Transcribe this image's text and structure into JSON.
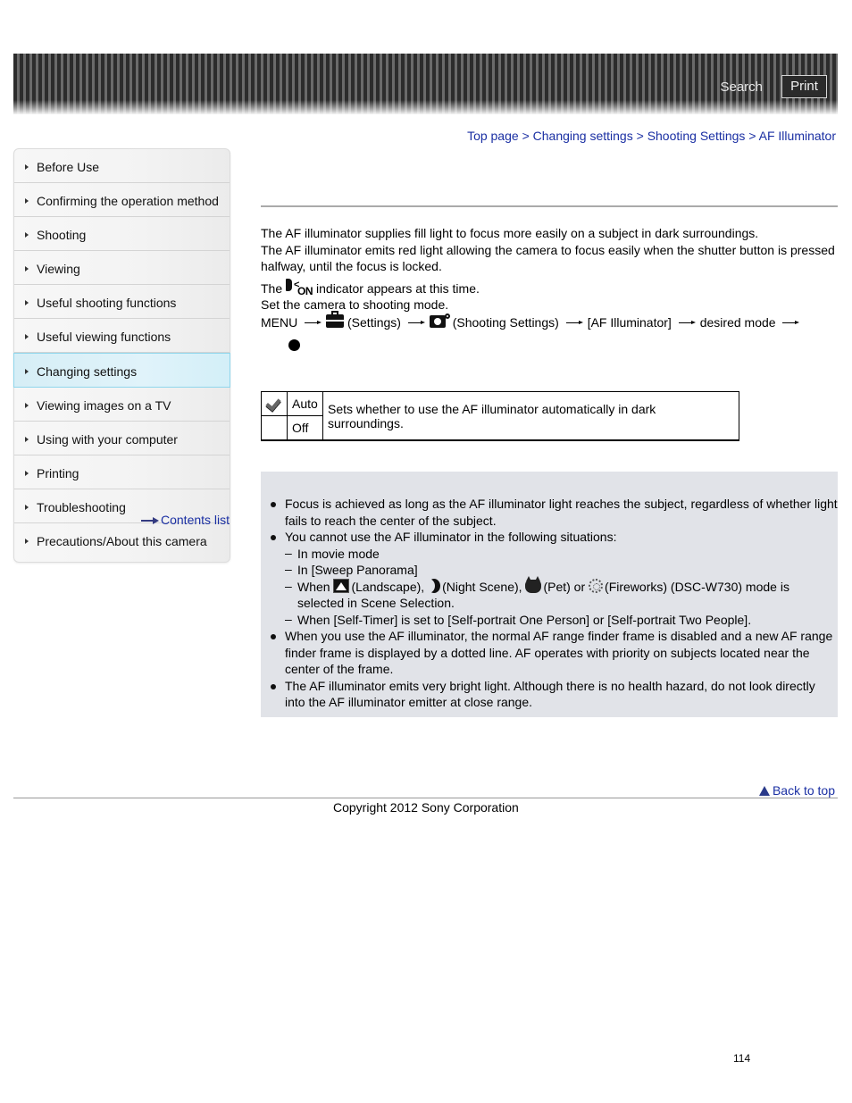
{
  "header": {
    "search_label": "Search",
    "print_label": "Print"
  },
  "breadcrumb": {
    "items": [
      "Top page",
      "Changing settings",
      "Shooting Settings",
      "AF Illuminator"
    ],
    "separator": ">"
  },
  "sidebar": {
    "items": [
      {
        "label": "Before Use"
      },
      {
        "label": "Confirming the operation method"
      },
      {
        "label": "Shooting"
      },
      {
        "label": "Viewing"
      },
      {
        "label": "Useful shooting functions"
      },
      {
        "label": "Useful viewing functions"
      },
      {
        "label": "Changing settings",
        "selected": true
      },
      {
        "label": "Viewing images on a TV"
      },
      {
        "label": "Using with your computer"
      },
      {
        "label": "Printing"
      },
      {
        "label": "Troubleshooting"
      },
      {
        "label": "Precautions/About this camera"
      }
    ],
    "contents_list_label": "Contents list"
  },
  "main": {
    "intro_1": "The AF illuminator supplies fill light to focus more easily on a subject in dark surroundings.",
    "intro_2": "The AF illuminator emits red light allowing the camera to focus easily when the shutter button is pressed halfway, until the focus is locked.",
    "indicator_prefix": "The",
    "indicator_icon_text": "ON",
    "indicator_suffix": "indicator appears at this time.",
    "step_1": "Set the camera to shooting mode.",
    "step_2": {
      "menu": "MENU",
      "settings": "(Settings)",
      "shooting_settings": "(Shooting Settings)",
      "af_illuminator": "[AF Illuminator]",
      "desired_mode": "desired mode"
    }
  },
  "options_table": {
    "rows": [
      {
        "label": "Auto",
        "default": true
      },
      {
        "label": "Off",
        "default": false
      }
    ],
    "description": "Sets whether to use the AF illuminator automatically in dark surroundings."
  },
  "notes": {
    "bullet_1": "Focus is achieved as long as the AF illuminator light reaches the subject, regardless of whether light fails to reach the center of the subject.",
    "bullet_2": "You cannot use the AF illuminator in the following situations:",
    "sub_1": "In movie mode",
    "sub_2": "In [Sweep Panorama]",
    "sub_3": {
      "when": "When",
      "landscape": "(Landscape),",
      "night": "(Night Scene),",
      "pet": "(Pet) or",
      "fireworks": "(Fireworks) (DSC-W730) mode is selected in Scene Selection."
    },
    "sub_4": "When [Self-Timer] is set to [Self-portrait One Person] or [Self-portrait Two People].",
    "bullet_3": "When you use the AF illuminator, the normal AF range finder frame is disabled and a new AF range finder frame is displayed by a dotted line. AF operates with priority on subjects located near the center of the frame.",
    "bullet_4": "The AF illuminator emits very bright light. Although there is no health hazard, do not look directly into the AF illuminator emitter at close range."
  },
  "footer": {
    "back_to_top": "Back to top",
    "copyright": "Copyright 2012 Sony Corporation",
    "page_number": "114"
  },
  "colors": {
    "link": "#1a2fa3",
    "selected_bg": "#d6eef6",
    "selected_border": "#8fd6ec",
    "notes_bg": "#e1e3e8"
  }
}
